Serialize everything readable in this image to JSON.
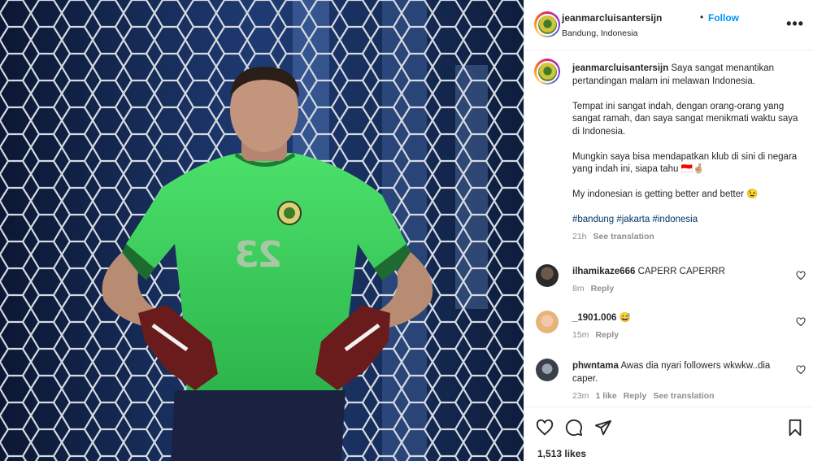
{
  "post": {
    "username": "jeanmarcluisantersijn",
    "follow_label": "Follow",
    "separator": "•",
    "location": "Bandung, Indonesia",
    "more_label": "•••",
    "jersey_number": "23"
  },
  "caption": {
    "username": "jeanmarcluisantersijn",
    "paragraph_1": "Saya sangat menantikan pertandingan malam ini melawan Indonesia.",
    "paragraph_2": "Tempat ini sangat indah, dengan orang-orang yang sangat ramah, dan saya sangat menikmati waktu saya di Indonesia.",
    "paragraph_3": "Mungkin saya bisa mendapatkan klub di sini di negara yang indah ini, siapa tahu 🇮🇩🤞🏼",
    "paragraph_4": "My indonesian is getting better and better 😉",
    "hashtags": "#bandung #jakarta #indonesia",
    "time": "21h",
    "see_translation": "See translation"
  },
  "comments": [
    {
      "username": "ilhamikaze666",
      "text": "CAPERR CAPERRR",
      "time": "8m",
      "reply": "Reply"
    },
    {
      "username": "_1901.006",
      "text": "😅",
      "time": "15m",
      "reply": "Reply"
    },
    {
      "username": "phwntama",
      "text": "Awas dia nyari followers wkwkw..dia caper.",
      "time": "23m",
      "likes": "1 like",
      "reply": "Reply",
      "see_translation": "See translation"
    }
  ],
  "icons": [
    "heart-icon",
    "comment-icon",
    "share-icon",
    "bookmark-icon",
    "more-icon"
  ],
  "likes": "1,513 likes",
  "colors": {
    "follow": "#0095f6",
    "hashtag": "#00376b",
    "muted": "#8e8e8e",
    "jersey": "#3fcc5a"
  }
}
